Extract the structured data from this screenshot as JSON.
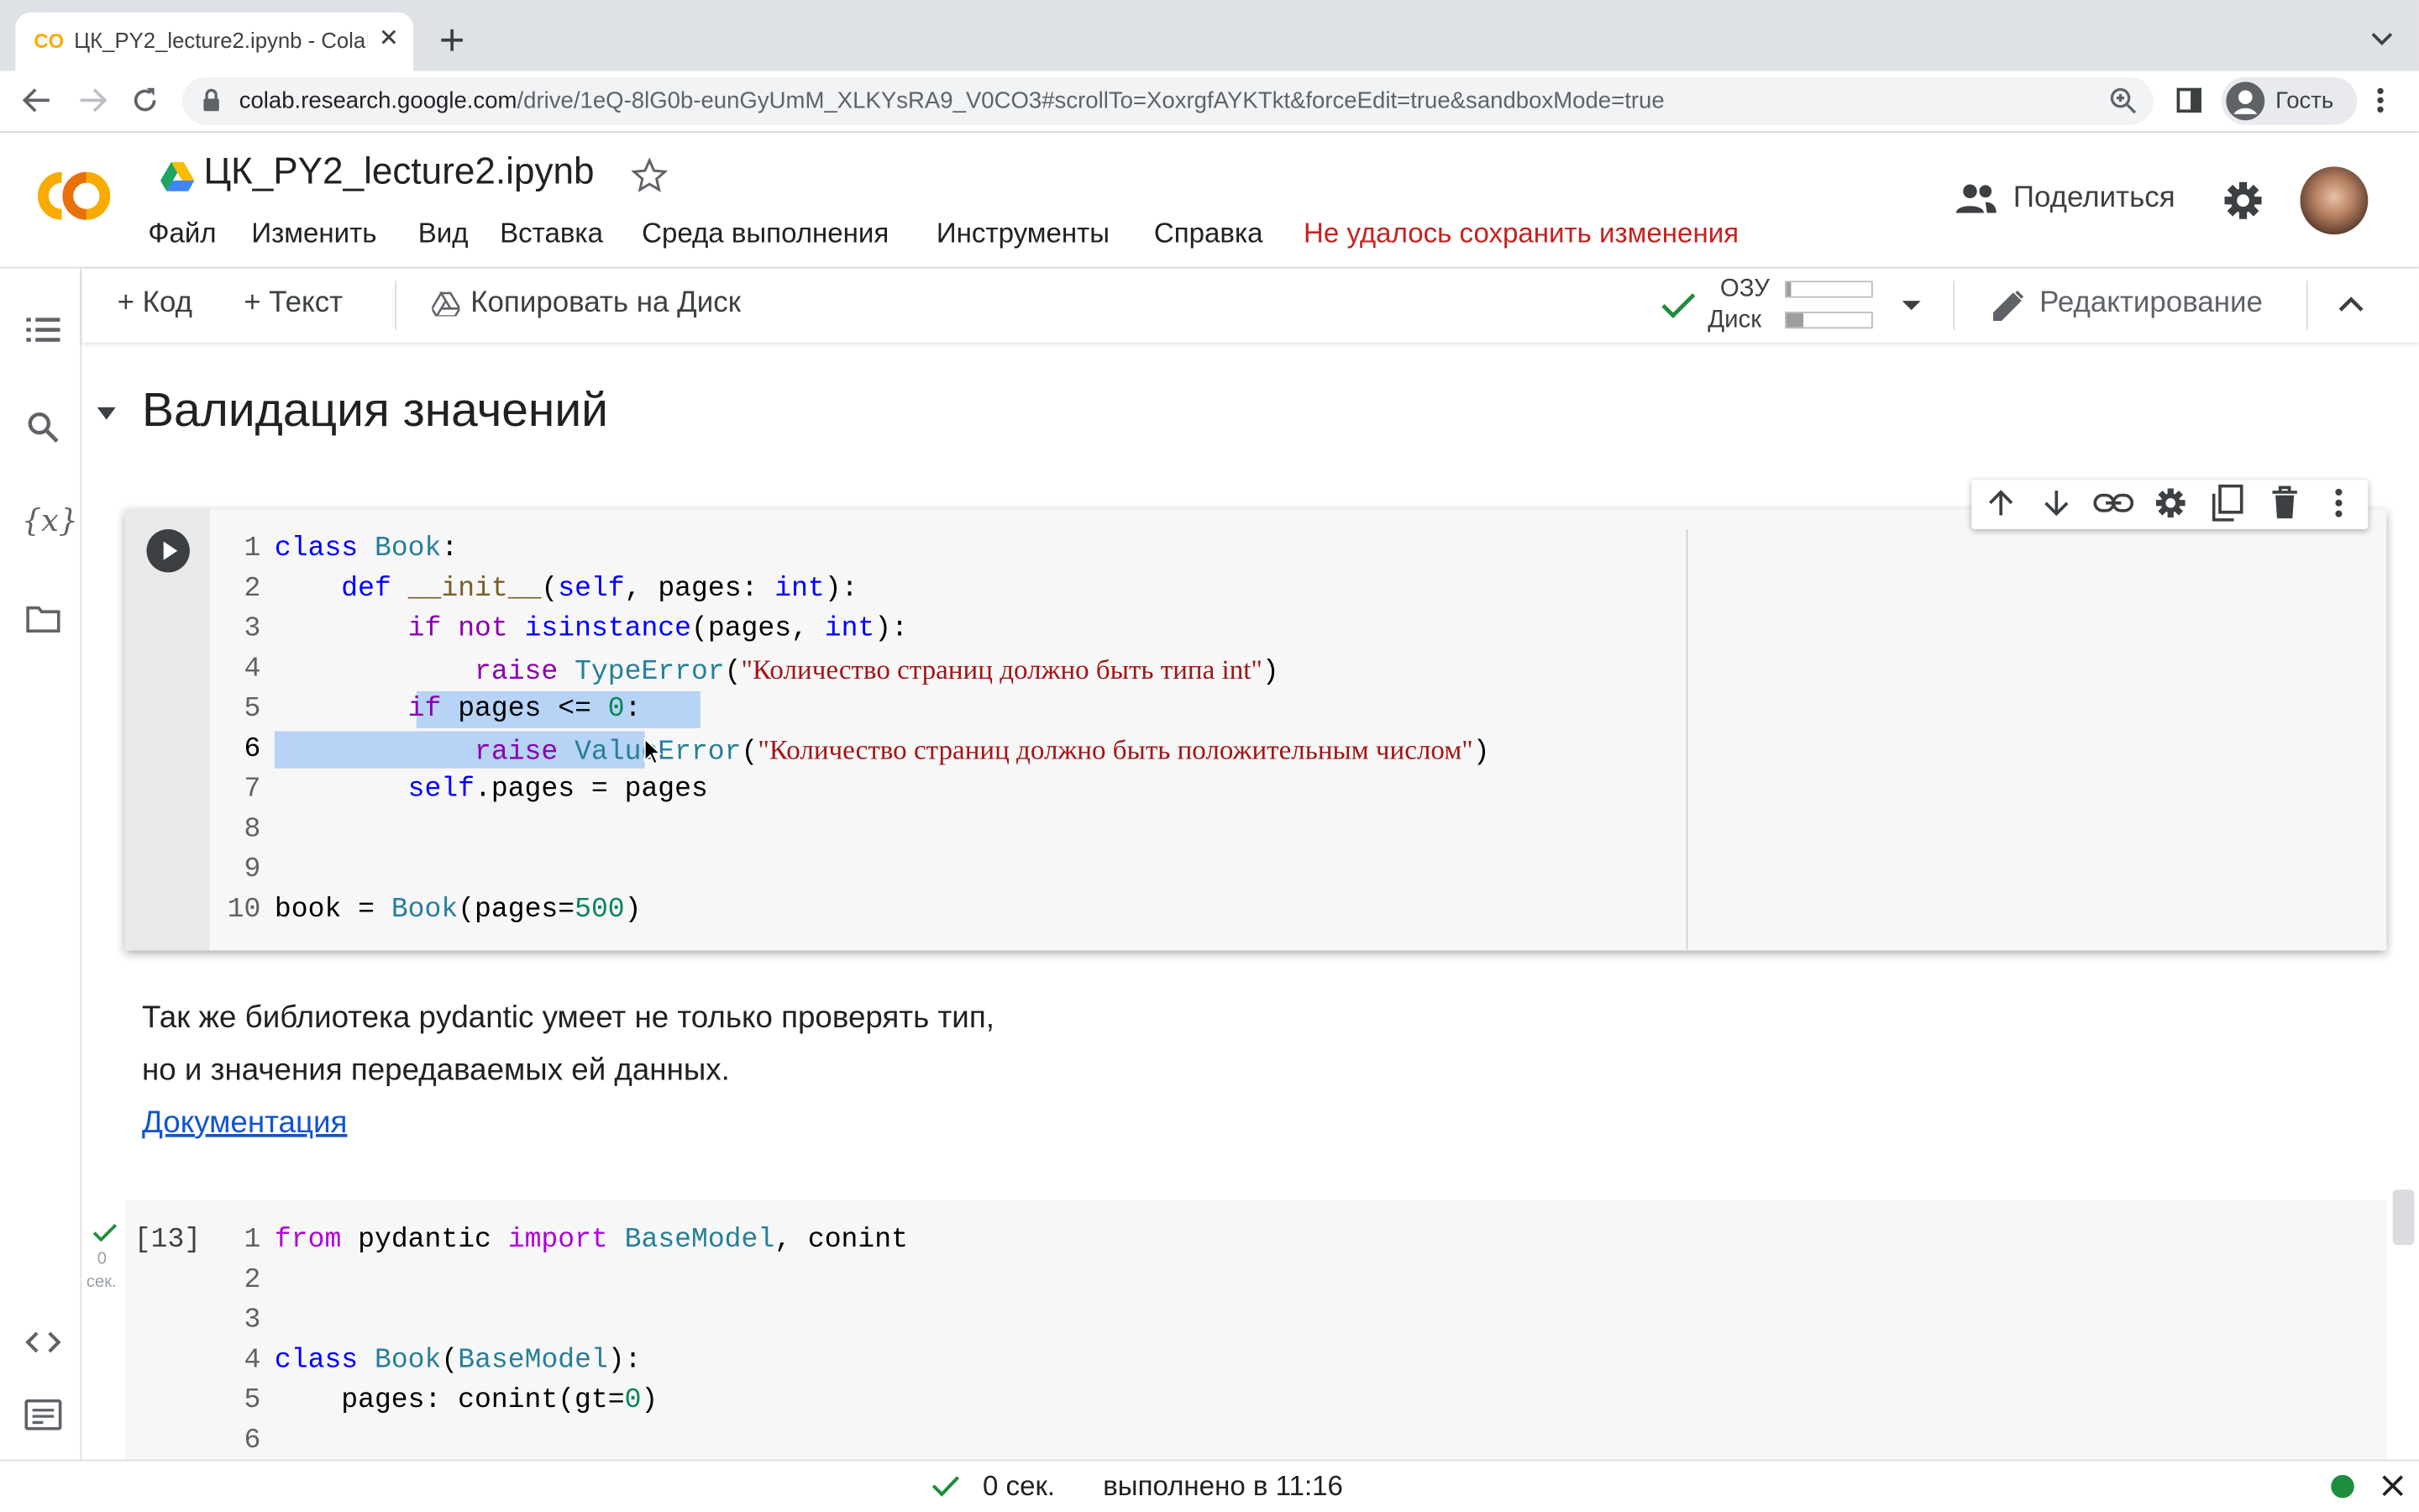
{
  "browser": {
    "tab_title": "ЦК_PY2_lecture2.ipynb - Colab",
    "url_host": "colab.research.google.com",
    "url_path": "/drive/1eQ-8lG0b-eunGyUmM_XLKYsRA9_V0CO3#scrollTo=XoxrgfAYKTkt&forceEdit=true&sandboxMode=true",
    "profile_label": "Гость"
  },
  "header": {
    "logo_text": "CO",
    "doc_title": "ЦК_PY2_lecture2.ipynb",
    "menu": [
      "Файл",
      "Изменить",
      "Вид",
      "Вставка",
      "Среда выполнения",
      "Инструменты",
      "Справка"
    ],
    "save_error": "Не удалось сохранить изменения",
    "share_label": "Поделиться"
  },
  "toolbar": {
    "add_code": "Код",
    "add_text": "Текст",
    "copy_to_drive": "Копировать на Диск",
    "ram_label": "ОЗУ",
    "disk_label": "Диск",
    "ram_usage": 0.05,
    "disk_usage": 0.2,
    "edit_mode": "Редактирование"
  },
  "sidebar": {
    "icons": [
      "toc-icon",
      "search-icon",
      "variables-icon",
      "files-icon",
      "code-snippets-icon",
      "terminal-icon"
    ],
    "variables_glyph": "{x}"
  },
  "notebook": {
    "section_title": "Валидация значений",
    "cell1": {
      "line_numbers": [
        "1",
        "2",
        "3",
        "4",
        "5",
        "6",
        "7",
        "8",
        "9",
        "10"
      ],
      "lines": [
        "class Book:",
        "    def __init__(self, pages: int):",
        "        if not isinstance(pages, int):",
        "            raise TypeError(\"Количество страниц должно быть типа int\")",
        "        if pages <= 0:",
        "            raise ValueError(\"Количество страниц должно быть положительным числом\")",
        "        self.pages = pages",
        "",
        "",
        "book = Book(pages=500)"
      ]
    },
    "text_cell": {
      "line1": "Так же библиотека pydantic умеет не только проверять тип,",
      "line2": "но и значения передаваемых ей данных.",
      "link": "Документация"
    },
    "cell2": {
      "exec_count": "[13]",
      "exec_time": "0",
      "exec_time_unit": "сек.",
      "line_numbers": [
        "1",
        "2",
        "3",
        "4",
        "5",
        "6"
      ],
      "lines": [
        "from pydantic import BaseModel, conint",
        "",
        "",
        "class Book(BaseModel):",
        "    pages: conint(gt=0)",
        ""
      ]
    }
  },
  "statusbar": {
    "duration": "0 сек.",
    "completed": "выполнено в 11:16"
  },
  "colors": {
    "save_error": "#c5221f",
    "keyword": "#8a00b0",
    "builtin": "#0000ff",
    "string": "#a31515",
    "number": "#098658",
    "class": "#267f99",
    "selection": "#b7d3f5",
    "status_ok": "#1e8e3e"
  }
}
